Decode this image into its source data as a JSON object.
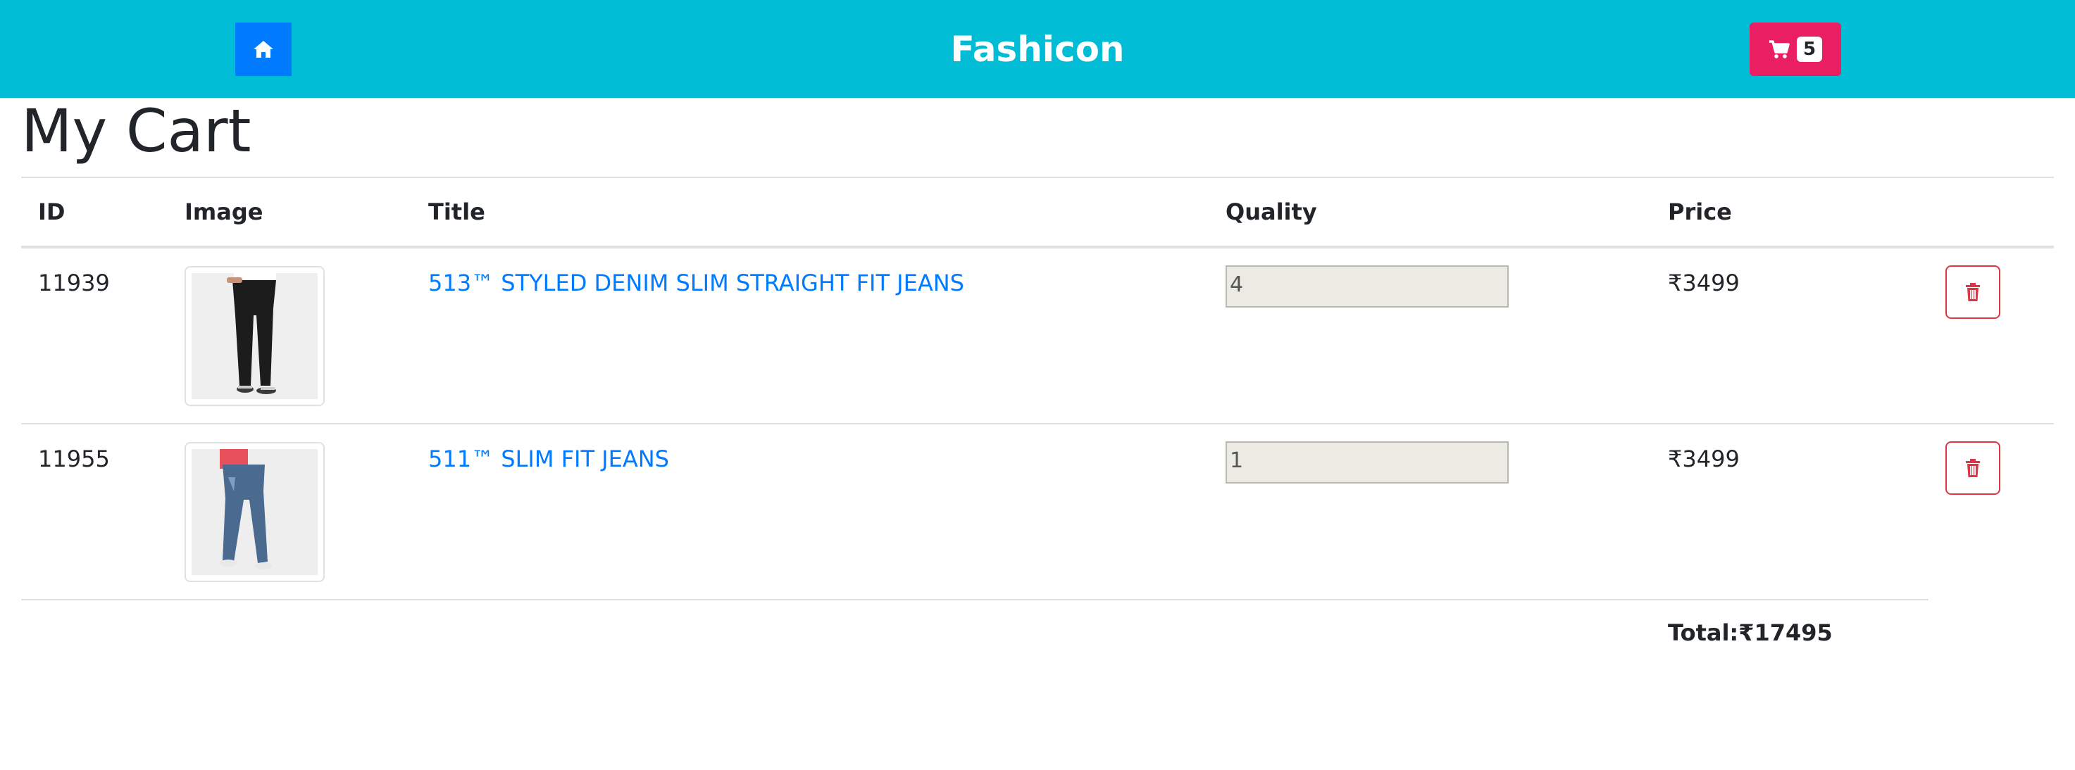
{
  "header": {
    "brand": "Fashicon",
    "cart_count": "5",
    "home_icon": "home-icon",
    "cart_icon": "shopping-cart-icon",
    "colors": {
      "navbar": "#00bcd4",
      "home_button": "#007bff",
      "cart_button": "#e91e63"
    }
  },
  "page": {
    "title": "My Cart"
  },
  "table": {
    "columns": [
      "ID",
      "Image",
      "Title",
      "Quality",
      "Price"
    ],
    "rows": [
      {
        "id": "11939",
        "image": "black-jeans-product-image",
        "title": "513™ STYLED DENIM SLIM STRAIGHT FIT JEANS",
        "quantity": "4",
        "price": "₹3499",
        "delete_icon": "trash-icon"
      },
      {
        "id": "11955",
        "image": "blue-jeans-product-image",
        "title": "511™ SLIM FIT JEANS",
        "quantity": "1",
        "price": "₹3499",
        "delete_icon": "trash-icon"
      }
    ],
    "total": "Total:₹17495"
  }
}
